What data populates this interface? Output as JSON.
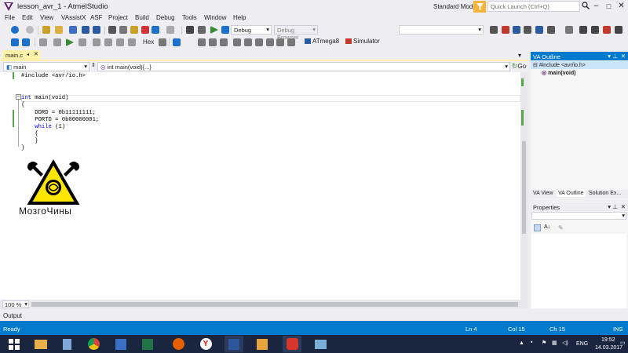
{
  "window": {
    "title": "lesson_avr_1 - AtmelStudio",
    "mode": "Standard Mode",
    "quick_launch_placeholder": "Quick Launch (Ctrl+Q)"
  },
  "menu": [
    "File",
    "Edit",
    "View",
    "VAssistX",
    "ASF",
    "Project",
    "Build",
    "Debug",
    "Tools",
    "Window",
    "Help"
  ],
  "toolbar": {
    "config_dropdown": "Debug",
    "debug_browser": "Debug Browser",
    "hex_label": "Hex",
    "device": "ATmega8",
    "tool": "Simulator"
  },
  "editor": {
    "tab_name": "main.c",
    "nav_left": "main",
    "nav_right": "int main(void){...}",
    "go_label": "Go",
    "zoom": "100 %",
    "code": [
      {
        "kw": "",
        "text": "#include <avr/io.h>"
      },
      {
        "kw": "",
        "text": ""
      },
      {
        "kw": "",
        "text": ""
      },
      {
        "kw": "int",
        "text": " main(void)"
      },
      {
        "kw": "",
        "text": "{"
      },
      {
        "kw": "",
        "text": "    DDRD = 0b11111111;"
      },
      {
        "kw": "",
        "text": "    PORTD = 0b00000001;"
      },
      {
        "kw": "while",
        "text": " (1)",
        "indent": "    "
      },
      {
        "kw": "",
        "text": "    {"
      },
      {
        "kw": "",
        "text": "    }"
      },
      {
        "kw": "",
        "text": "}"
      }
    ],
    "watermark_text": "МозгоЧины"
  },
  "va_outline": {
    "title": "VA Outline",
    "items": [
      "#include <avr/io.h>",
      "main(void)"
    ],
    "tabs": [
      "VA View",
      "VA Outline",
      "Solution Ex..."
    ]
  },
  "properties": {
    "title": "Properties"
  },
  "output": {
    "label": "Output"
  },
  "status": {
    "ready": "Ready",
    "ln": "Ln 4",
    "col": "Col 15",
    "ch": "Ch 15",
    "ins": "INS"
  },
  "taskbar": {
    "lang": "ENG",
    "time": "19:52",
    "date": "14.03.2017"
  },
  "colors": {
    "accent": "#007acc",
    "tab_active": "#fff1a8",
    "keyword": "#0000ff",
    "taskbar": "#1a2640"
  }
}
